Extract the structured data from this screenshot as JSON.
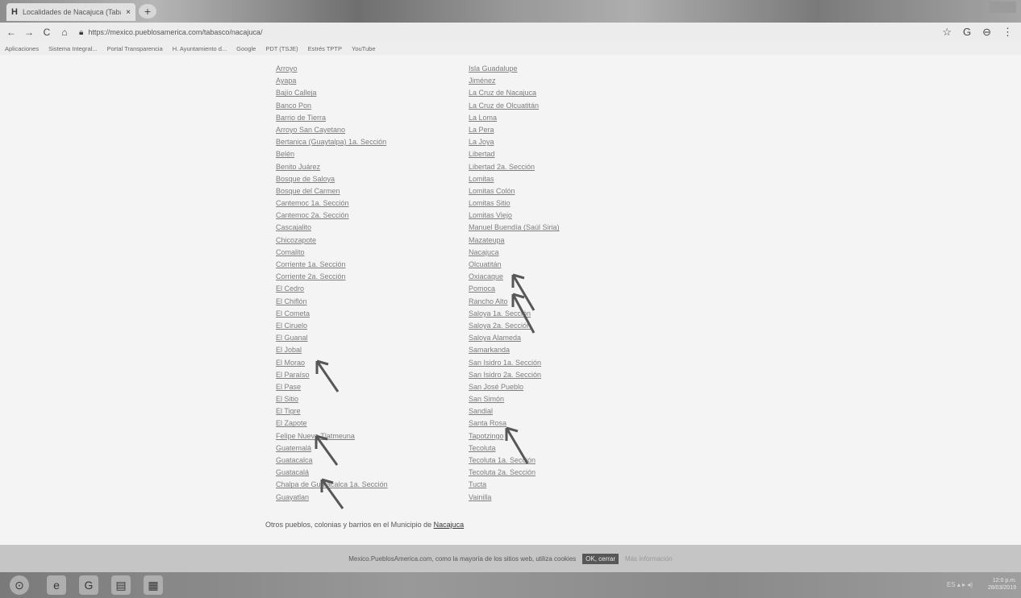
{
  "browser": {
    "tab_favicon": "H",
    "tab_title": "Localidades de Nacajuca (Tabas",
    "tab_close": "×",
    "new_tab": "+",
    "url": "https://mexico.pueblosamerica.com/tabasco/nacajuca/",
    "nav": {
      "back": "←",
      "forward": "→",
      "reload": "C",
      "home": "⌂"
    },
    "right_icons": {
      "star": "☆",
      "extension": "G",
      "profile": "⊖",
      "menu": "⋮"
    },
    "bookmarks": [
      "Aplicaciones",
      "Sistema Integral...",
      "Portal Transparencia",
      "H. Ayuntamiento d...",
      "Google",
      "PDT (TSJE)",
      "Estrés TPTP",
      "YouTube"
    ]
  },
  "localities_col1": [
    "Arroyo",
    "Ayapa",
    "Bajío Calleja",
    "Banco Pon",
    "Barrio de Tierra",
    "Arroyo San Cayetano",
    "Bertanica (Guaytalpa) 1a. Sección",
    "Belén",
    "Benito Juárez",
    "Bosque de Saloya",
    "Bosque del Carmen",
    "Cantemoc 1a. Sección",
    "Cantemoc 2a. Sección",
    "Cascajalito",
    "Chicozapote",
    "Comalito",
    "Corriente 1a. Sección",
    "Corriente 2a. Sección",
    "El Cedro",
    "El Chiflón",
    "El Cometa",
    "El Ciruelo",
    "El Guanal",
    "El Jobal",
    "El Morao",
    "El Paraíso",
    "El Pase",
    "El Sitio",
    "El Tigre",
    "El Zapote",
    "Felipe Nuevo Tlatmeuna",
    "Guatemalá",
    "Guatacalca",
    "Guatacalá",
    "Chalpa de Guatacalca 1a. Sección",
    "Guayatlan"
  ],
  "localities_col2": [
    "Isla Guadalupe",
    "Jiménez",
    "La Cruz de Nacajuca",
    "La Cruz de Olcuatitán",
    "La Loma",
    "La Pera",
    "La Joya",
    "Libertad",
    "Libertad 2a. Sección",
    "Lomitas",
    "Lomitas Colón",
    "Lomitas Sitio",
    "Lomitas Viejo",
    "Manuel Buendía (Saúl Siria)",
    "Mazateupa",
    "Nacajuca",
    "Olcuatitán",
    "Oxiacaque",
    "Pomoca",
    "Rancho Alto",
    "Saloya 1a. Sección",
    "Saloya 2a. Sección",
    "Saloya Alameda",
    "Samarkanda",
    "San Isidro 1a. Sección",
    "San Isidro 2a. Sección",
    "San José Pueblo",
    "San Simón",
    "Sandial",
    "Santa Rosa",
    "Tapotzingo",
    "Tecoluta",
    "Tecoluta 1a. Sección",
    "Tecoluta 2a. Sección",
    "Tucta",
    "Vainilla"
  ],
  "footnote_prefix": "Otros pueblos, colonias y barrios en el Municipio de",
  "footnote_link": "Nacajuca",
  "cookie": {
    "text": "Mexico.PueblosAmerica.com, como la mayoría de los sitios web, utiliza cookies",
    "ok_label": "OK, cerrar",
    "more_label": "Más información"
  },
  "taskbar": {
    "icons": [
      "⊙",
      "e",
      "G",
      "▤",
      "▦"
    ],
    "tray": "ES ▴ ▸ ◂)",
    "time": "12:0 p.m.",
    "date": "28/03/2019"
  },
  "colors": {
    "link": "#6f7f9a",
    "arrow": "#555555",
    "cookie_bg": "#c9c9c9"
  }
}
